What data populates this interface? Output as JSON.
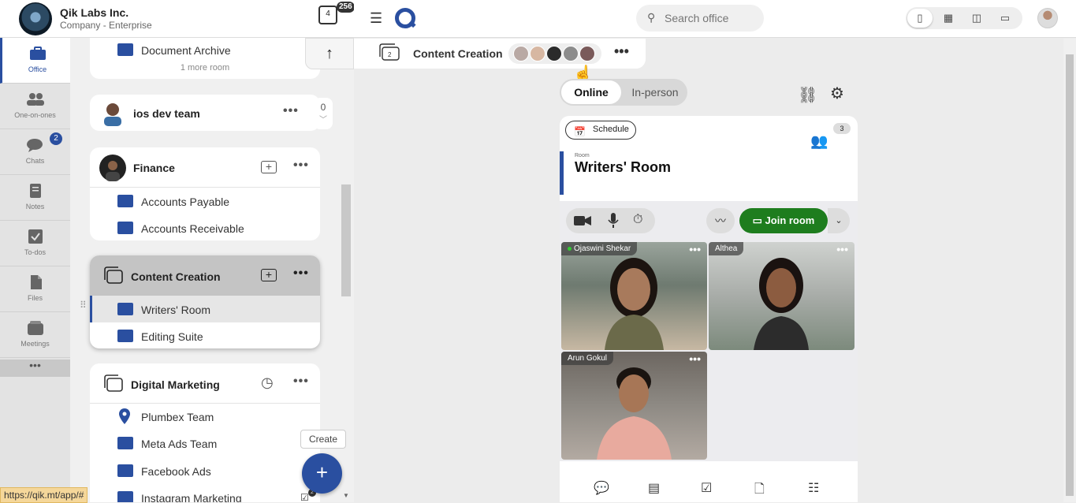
{
  "org": {
    "name": "Qik Labs Inc.",
    "plan": "Company - Enterprise",
    "inbox_count": "4",
    "inbox_badge": "256"
  },
  "rail": {
    "items": [
      {
        "label": "Office",
        "icon": "briefcase-icon"
      },
      {
        "label": "One-on-ones",
        "icon": "people-icon"
      },
      {
        "label": "Chats",
        "icon": "chat-icon"
      },
      {
        "label": "Notes",
        "icon": "notes-icon"
      },
      {
        "label": "To-dos",
        "icon": "todo-icon"
      },
      {
        "label": "Files",
        "icon": "files-icon"
      },
      {
        "label": "Meetings",
        "icon": "meetings-icon"
      }
    ],
    "chats_badge": "2",
    "more": "•••"
  },
  "spaces": {
    "archive": {
      "room": "Document Archive",
      "more_rooms": "1 more room"
    },
    "ios": {
      "title": "ios dev team",
      "count": "0"
    },
    "finance": {
      "title": "Finance",
      "rooms": [
        "Accounts Payable",
        "Accounts Receivable"
      ]
    },
    "content": {
      "title": "Content Creation",
      "rooms": [
        "Writers' Room",
        "Editing Suite"
      ]
    },
    "digital": {
      "title": "Digital Marketing",
      "rooms": [
        "Plumbex Team",
        "Meta Ads Team",
        "Facebook Ads",
        "Instagram Marketing"
      ]
    },
    "create_tooltip": "Create",
    "create_button": "+",
    "status_url": "https://qik.mt/app/#",
    "instagram_badge": "2"
  },
  "topbar": {
    "search_placeholder": "Search office"
  },
  "strip": {
    "title": "Content Creation",
    "badge": "2"
  },
  "mode": {
    "online": "Online",
    "inperson": "In-person"
  },
  "room": {
    "schedule": "Schedule",
    "people_count": "3",
    "kicker": "Room",
    "title": "Writers' Room",
    "join": "Join room",
    "participants": [
      "Ojaswini Shekar",
      "Althea",
      "Arun Gokul"
    ]
  },
  "colors": {
    "accent": "#2a4fa0",
    "join": "#1e7d1e"
  }
}
